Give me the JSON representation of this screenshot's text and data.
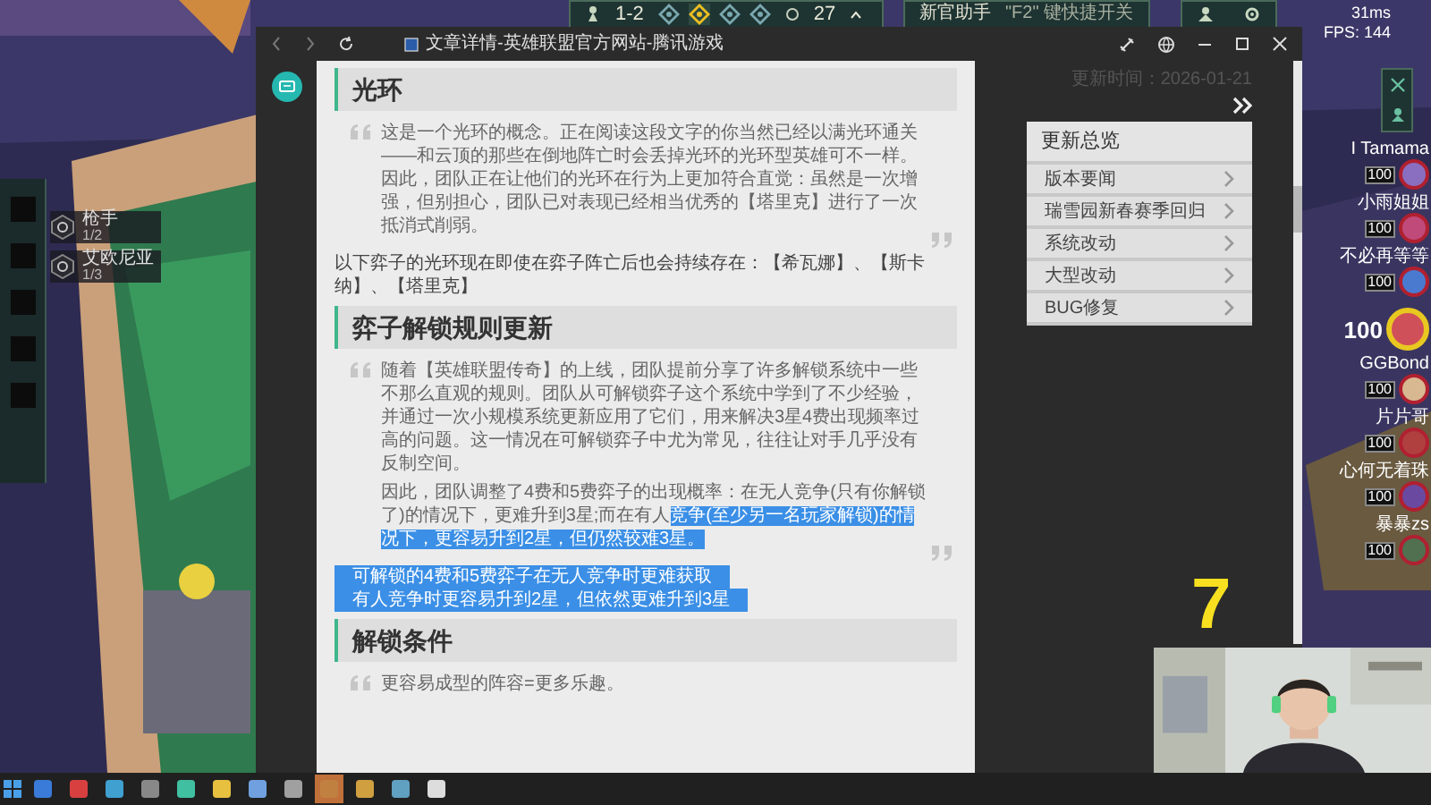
{
  "hud": {
    "stage": "1-2",
    "gold": "27",
    "helper_title": "新官助手",
    "helper_hint": "\"F2\" 键快捷开关",
    "ping": "31ms",
    "fps": "FPS: 144",
    "stages": [
      {
        "selected": false
      },
      {
        "selected": true
      },
      {
        "selected": false
      },
      {
        "selected": false
      }
    ]
  },
  "traits": [
    {
      "name": "枪手",
      "count": "1/2"
    },
    {
      "name": "艾欧尼亚",
      "count": "1/3"
    }
  ],
  "players": [
    {
      "name": "I Tamama",
      "health": "100",
      "self": false,
      "color": "#8a6fc0"
    },
    {
      "name": "小雨姐姐",
      "health": "100",
      "self": false,
      "color": "#c04a7a"
    },
    {
      "name": "不必再等等",
      "health": "100",
      "self": false,
      "color": "#4a7ad0"
    },
    {
      "health": "100",
      "self": true,
      "color": "#d0505a"
    },
    {
      "name": "GGBond",
      "health": "100",
      "self": false,
      "color": "#d8b890"
    },
    {
      "name": "片片哥",
      "health": "100",
      "self": false,
      "color": "#b04040"
    },
    {
      "name": "心何无着珠",
      "health": "100",
      "self": false,
      "color": "#6a4aa0"
    },
    {
      "name": "暴暴zs",
      "health": "100",
      "self": false,
      "color": "#507050"
    }
  ],
  "browser": {
    "title": "文章详情-英雄联盟官方网站-腾讯游戏",
    "updated": "更新时间：2026-01-21",
    "menu": {
      "title": "更新总览",
      "items": [
        "版本要闻",
        "瑞雪园新春赛季回归",
        "系统改动",
        "大型改动",
        "BUG修复"
      ]
    },
    "article": [
      {
        "kind": "heading",
        "text": "光环"
      },
      {
        "kind": "quote",
        "paragraphs": [
          [
            {
              "text": "这是一个光环的概念。正在阅读这段文字的你当然已经以满光环通关——和云顶的那些在倒地阵亡时会丢掉光环的光环型英雄可不一样。因此，团队正在让他们的光环在行为上更加符合直觉：虽然是一次增强，但别担心，团队已对表现已经相当优秀的【塔里克】进行了一次抵消式削弱。",
              "selected": false
            }
          ]
        ]
      },
      {
        "kind": "paragraph",
        "text": "以下弈子的光环现在即使在弈子阵亡后也会持续存在：【希瓦娜】、【斯卡纳】、【塔里克】"
      },
      {
        "kind": "heading",
        "text": "弈子解锁规则更新"
      },
      {
        "kind": "quote",
        "paragraphs": [
          [
            {
              "text": "随着【英雄联盟传奇】的上线，团队提前分享了许多解锁系统中一些不那么直观的规则。团队从可解锁弈子这个系统中学到了不少经验，并通过一次小规模系统更新应用了它们，用来解决3星4费出现频率过高的问题。这一情况在可解锁弈子中尤为常见，往往让对手几乎没有反制空间。",
              "selected": false
            }
          ],
          [
            {
              "text": "因此，团队调整了4费和5费弈子的出现概率：在无人竞争(只有你解锁了)的情况下，更难升到3星;而在有人",
              "selected": false
            },
            {
              "text": "竞争(至少另一名玩家解锁)的情况下，更容易升到2星，但仍然较难3星。",
              "selected": true
            }
          ]
        ]
      },
      {
        "kind": "lines",
        "lines": [
          {
            "text": "可解锁的4费和5费弈子在无人竞争时更难获取",
            "selected": true
          },
          {
            "text": "有人竞争时更容易升到2星，但依然更难升到3星",
            "selected": true
          }
        ]
      },
      {
        "kind": "heading",
        "text": "解锁条件"
      },
      {
        "kind": "quote",
        "paragraphs": [
          [
            {
              "text": "更容易成型的阵容=更多乐趣。",
              "selected": false
            }
          ]
        ]
      }
    ]
  },
  "countdown": "7",
  "taskbar": {
    "apps": [
      {
        "selected": false
      },
      {
        "selected": false
      },
      {
        "selected": false
      },
      {
        "selected": false
      },
      {
        "selected": false
      },
      {
        "selected": false
      },
      {
        "selected": false
      },
      {
        "selected": false
      },
      {
        "selected": true
      },
      {
        "selected": false
      },
      {
        "selected": false
      },
      {
        "selected": false
      }
    ]
  }
}
